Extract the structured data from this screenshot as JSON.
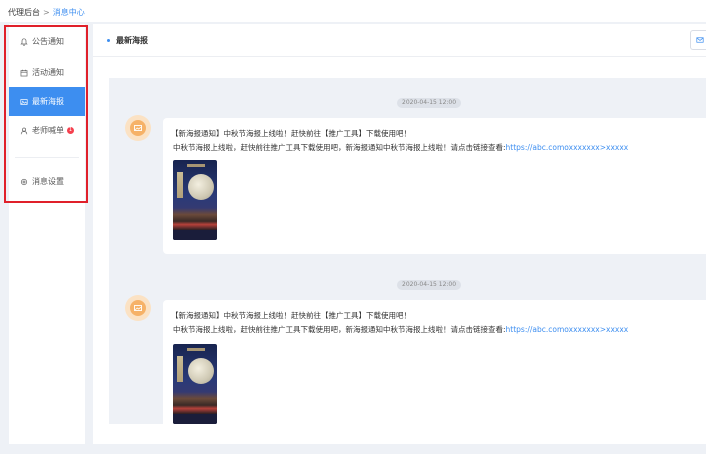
{
  "breadcrumb": {
    "root": "代理后台",
    "separator": ">",
    "current": "消息中心"
  },
  "sidebar": {
    "items": [
      {
        "label": "公告通知",
        "icon": "bell-icon",
        "active": false
      },
      {
        "label": "活动通知",
        "icon": "calendar-icon",
        "active": false
      },
      {
        "label": "最新海报",
        "icon": "image-icon",
        "active": true
      },
      {
        "label": "老师喊单",
        "icon": "user-icon",
        "active": false,
        "badge": "1"
      }
    ],
    "settings": {
      "label": "消息设置",
      "icon": "gear-icon"
    }
  },
  "main": {
    "tab": {
      "label": "最新海报"
    },
    "action_icon": "mail-icon",
    "messages": [
      {
        "time": "2020-04-15 12:00",
        "line1": "【新海报通知】中秋节海报上线啦！赶快前往【推广工具】下载使用吧！",
        "line2": "中秋节海报上线啦，赶快前往推广工具下载使用吧，新海报通知中秋节海报上线啦！请点击链接查看:",
        "link": "https://abc.comoxxxxxxx>xxxxx"
      },
      {
        "time": "2020-04-15 12:00",
        "line1": "【新海报通知】中秋节海报上线啦！赶快前往【推广工具】下载使用吧！",
        "line2": "中秋节海报上线啦，赶快前往推广工具下载使用吧，新海报通知中秋节海报上线啦！请点击链接查看:",
        "link": "https://abc.comoxxxxxxx>xxxxx"
      }
    ]
  },
  "colors": {
    "accent": "#3d8ef0",
    "highlight_border": "#e0202a",
    "badge": "#f5404e",
    "avatar": "#f6b268"
  }
}
